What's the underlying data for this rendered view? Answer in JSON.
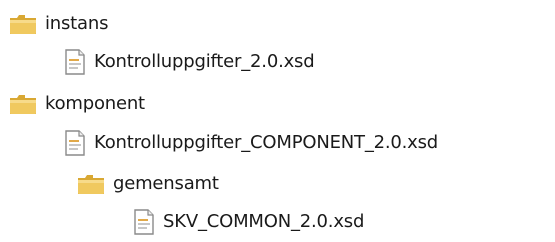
{
  "tree": {
    "items": [
      {
        "type": "folder",
        "label": "instans",
        "icon": "folder-icon"
      },
      {
        "type": "file",
        "label": "Kontrolluppgifter_2.0.xsd",
        "icon": "xsd-file-icon"
      },
      {
        "type": "folder",
        "label": "komponent",
        "icon": "folder-icon"
      },
      {
        "type": "file",
        "label": "Kontrolluppgifter_COMPONENT_2.0.xsd",
        "icon": "xsd-file-icon"
      },
      {
        "type": "folder",
        "label": "gemensamt",
        "icon": "folder-icon"
      },
      {
        "type": "file",
        "label": "SKV_COMMON_2.0.xsd",
        "icon": "xsd-file-icon"
      }
    ]
  },
  "colors": {
    "folder_body": "#e8c25a",
    "folder_tab": "#d9a833",
    "file_border": "#8a8a8a",
    "file_accent": "#e1a94a"
  }
}
